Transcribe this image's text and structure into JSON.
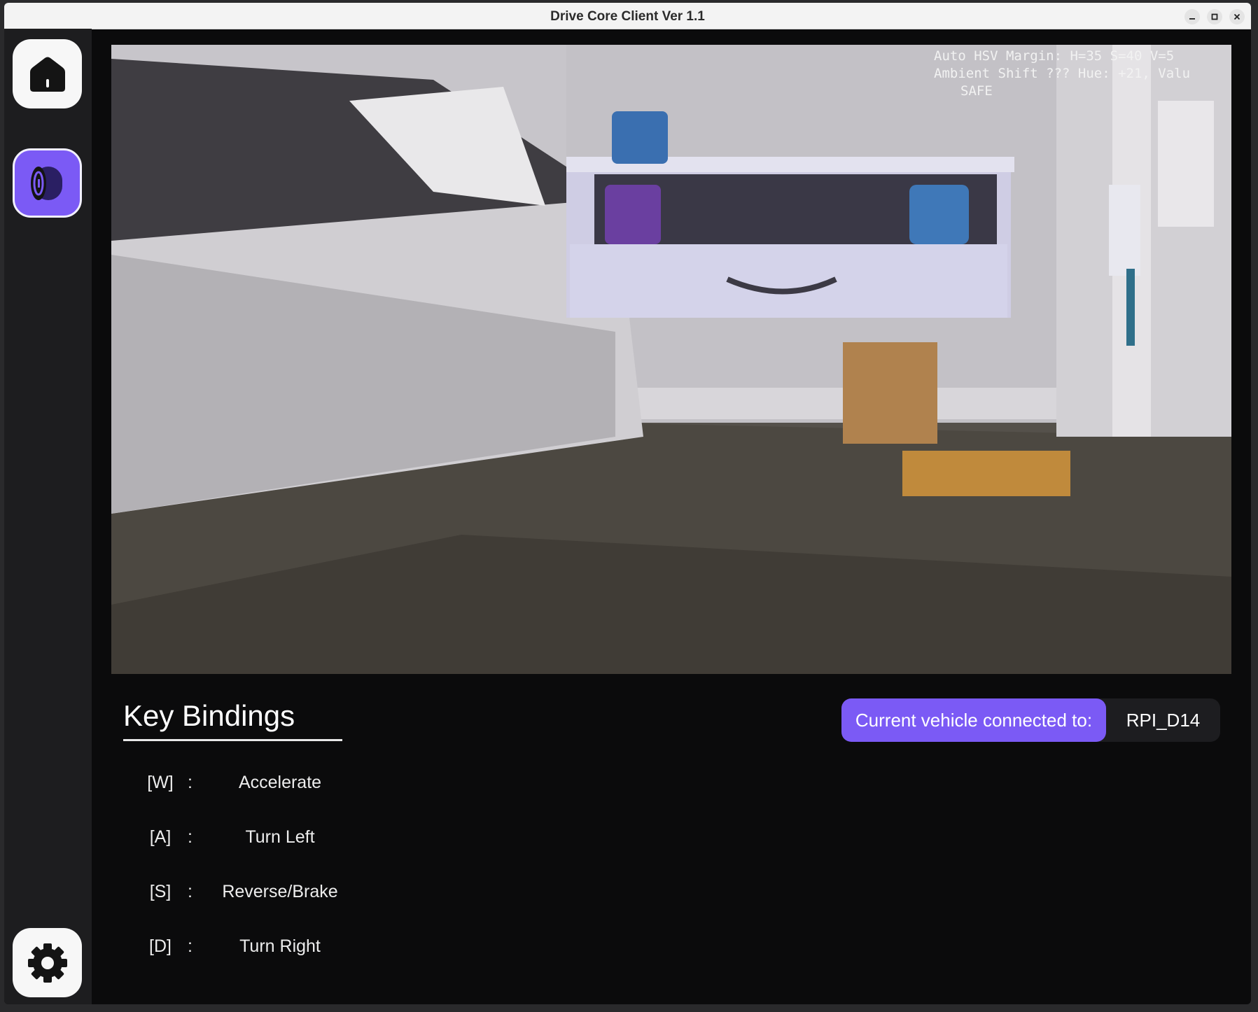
{
  "window": {
    "title": "Drive Core Client Ver 1.1",
    "controls": [
      "minimize-icon",
      "maximize-icon",
      "close-icon"
    ]
  },
  "sidebar": {
    "items": [
      {
        "name": "home",
        "icon": "home-icon",
        "active": false
      },
      {
        "name": "drive",
        "icon": "wheel-icon",
        "active": true
      },
      {
        "name": "settings",
        "icon": "gear-icon",
        "active": false
      }
    ]
  },
  "camera": {
    "overlay_line1": "Auto HSV Margin: H=35 S=40 V=5",
    "overlay_line2": "Ambient Shift ??? Hue: +21, Valu",
    "overlay_status": "SAFE"
  },
  "key_bindings": {
    "title": "Key Bindings",
    "items": [
      {
        "key": "[W]",
        "sep": ":",
        "action": "Accelerate"
      },
      {
        "key": "[A]",
        "sep": ":",
        "action": "Turn Left"
      },
      {
        "key": "[S]",
        "sep": ":",
        "action": "Reverse/Brake"
      },
      {
        "key": "[D]",
        "sep": ":",
        "action": "Turn Right"
      }
    ]
  },
  "connection": {
    "label": "Current vehicle connected to:",
    "vehicle": "RPI_D14"
  },
  "colors": {
    "accent": "#7b5af5",
    "background": "#0b0b0c",
    "sidebar": "#1d1d1f"
  }
}
